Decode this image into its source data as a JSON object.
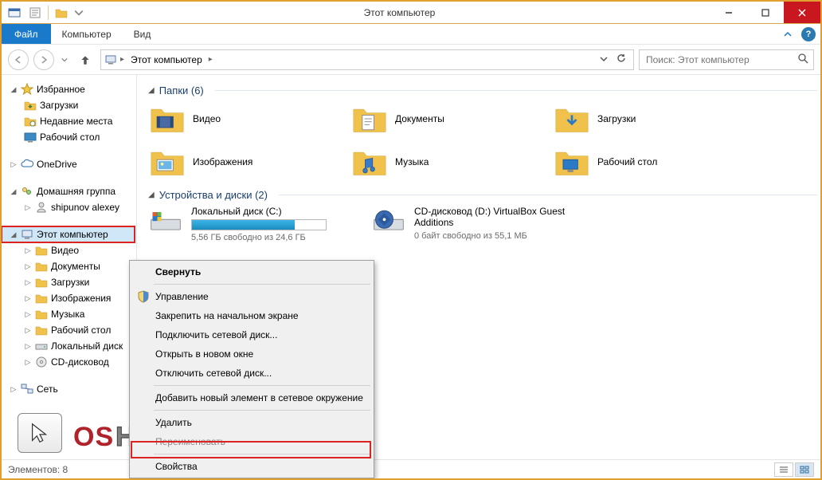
{
  "window": {
    "title": "Этот компьютер"
  },
  "menubar": {
    "file": "Файл",
    "computer": "Компьютер",
    "view": "Вид"
  },
  "address": {
    "crumb": "Этот компьютер"
  },
  "search": {
    "placeholder": "Поиск: Этот компьютер"
  },
  "sidebar": {
    "favorites": "Избранное",
    "downloads": "Загрузки",
    "recent": "Недавние места",
    "desktop": "Рабочий стол",
    "onedrive": "OneDrive",
    "homegroup": "Домашняя группа",
    "homegroup_user": "shipunov alexey",
    "this_pc": "Этот компьютер",
    "video": "Видео",
    "documents": "Документы",
    "downloads2": "Загрузки",
    "images": "Изображения",
    "music": "Музыка",
    "desktop2": "Рабочий стол",
    "localdisk": "Локальный диск",
    "cddrive": "CD-дисковод",
    "network": "Сеть"
  },
  "content": {
    "folders_header": "Папки (6)",
    "devices_header": "Устройства и диски (2)",
    "folders": {
      "video": "Видео",
      "documents": "Документы",
      "downloads": "Загрузки",
      "images": "Изображения",
      "music": "Музыка",
      "desktop": "Рабочий стол"
    },
    "drive_c": {
      "name": "Локальный диск (C:)",
      "status": "5,56 ГБ свободно из 24,6 ГБ",
      "fill_percent": 77
    },
    "drive_d": {
      "name": "CD-дисковод (D:) VirtualBox Guest Additions",
      "status": "0 байт свободно из 55,1 МБ"
    }
  },
  "context_menu": {
    "collapse": "Свернуть",
    "manage": "Управление",
    "pin_start": "Закрепить на начальном экране",
    "map_drive": "Подключить сетевой диск...",
    "open_new": "Открыть в новом окне",
    "disconnect_drive": "Отключить сетевой диск...",
    "add_network": "Добавить новый элемент в сетевое окружение",
    "delete": "Удалить",
    "rename": "Переименовать",
    "properties": "Свойства"
  },
  "statusbar": {
    "items": "Элементов: 8"
  },
  "watermark": {
    "p1": "OS",
    "p2": "Helper"
  }
}
